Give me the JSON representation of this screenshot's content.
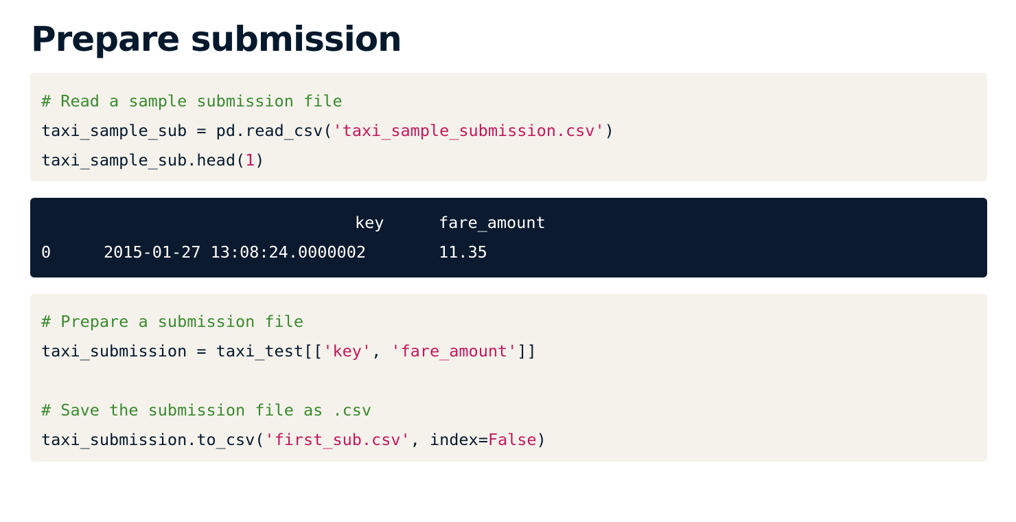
{
  "title": "Prepare submission",
  "cell1": {
    "comment": "# Read a sample submission file",
    "line2": {
      "code_a": "taxi_sample_sub = pd.read_csv(",
      "string": "'taxi_sample_submission.csv'",
      "code_b": ")"
    },
    "line3": {
      "code_a": "taxi_sample_sub.head(",
      "number": "1",
      "code_b": ")"
    }
  },
  "output": {
    "columns": [
      "key",
      "fare_amount"
    ],
    "rows": [
      {
        "index": "0",
        "key": "2015-01-27 13:08:24.0000002",
        "fare_amount": "11.35"
      }
    ]
  },
  "cell2": {
    "comment1": "# Prepare a submission file",
    "line2": {
      "code_a": "taxi_submission = taxi_test[[",
      "string1": "'key'",
      "sep": ", ",
      "string2": "'fare_amount'",
      "code_b": "]]"
    },
    "comment2": "# Save the submission file as .csv",
    "line5": {
      "code_a": "taxi_submission.to_csv(",
      "string": "'first_sub.csv'",
      "code_b": ", index=",
      "keyword": "False",
      "code_c": ")"
    }
  },
  "colors": {
    "title": "#05192d",
    "code_background": "#f5f2ec",
    "output_background": "#0b1a2e",
    "comment": "#3a8a2e",
    "string": "#c2185b"
  }
}
